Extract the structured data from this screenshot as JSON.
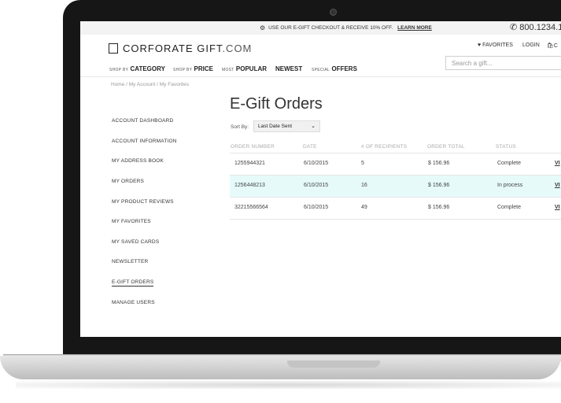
{
  "topbar": {
    "promo": "USE OUR E-GIFT CHECKOUT & RECEIVE 10% OFF.",
    "learn_more": "LEARN MORE",
    "phone": "800.1234.1"
  },
  "header": {
    "logo_main": "CORFORATE GIFT",
    "logo_domain": ".COM",
    "favorites": "FAVORITES",
    "login": "LOGIN",
    "cart": "C",
    "search_placeholder": "Search a gift..."
  },
  "nav": [
    {
      "prefix": "SHOP BY",
      "label": "CATEGORY"
    },
    {
      "prefix": "SHOP BY",
      "label": "PRICE"
    },
    {
      "prefix": "MOST",
      "label": "POPULAR"
    },
    {
      "prefix": "",
      "label": "NEWEST"
    },
    {
      "prefix": "SPECIAL",
      "label": "OFFERS"
    }
  ],
  "breadcrumb": "Home  /  My Account / My Favorites",
  "sidebar": [
    "ACCOUNT DASHBOARD",
    "ACCOUNT INFORMATION",
    "MY ADDRESS BOOK",
    "MY ORDERS",
    "MY PRODUCT REVIEWS",
    "MY FAVORITES",
    "MY SAVED CARDS",
    "NEWSLETTER",
    "E-GIFT ORDERS",
    "MANAGE USERS"
  ],
  "sidebar_active": "E-GIFT ORDERS",
  "main": {
    "title": "E-Gift Orders",
    "sort_label": "Sort By:",
    "sort_value": "Last Date Sent",
    "columns": [
      "ORDER NUMBER",
      "DATE",
      "# OF RECIPIENTS",
      "ORDER TOTAL",
      "STATUS"
    ],
    "rows": [
      {
        "order": "1255944321",
        "date": "6/10/2015",
        "recipients": "5",
        "total": "$ 156.96",
        "status": "Complete",
        "action": "VI"
      },
      {
        "order": "1256448213",
        "date": "6/10/2015",
        "recipients": "16",
        "total": "$ 156.96",
        "status": "In process",
        "action": "VI"
      },
      {
        "order": "32215566564",
        "date": "6/10/2015",
        "recipients": "49",
        "total": "$ 156.96",
        "status": "Complete",
        "action": "VI"
      }
    ],
    "highlight_row": 1,
    "highlight_color": "#e6fafa"
  }
}
